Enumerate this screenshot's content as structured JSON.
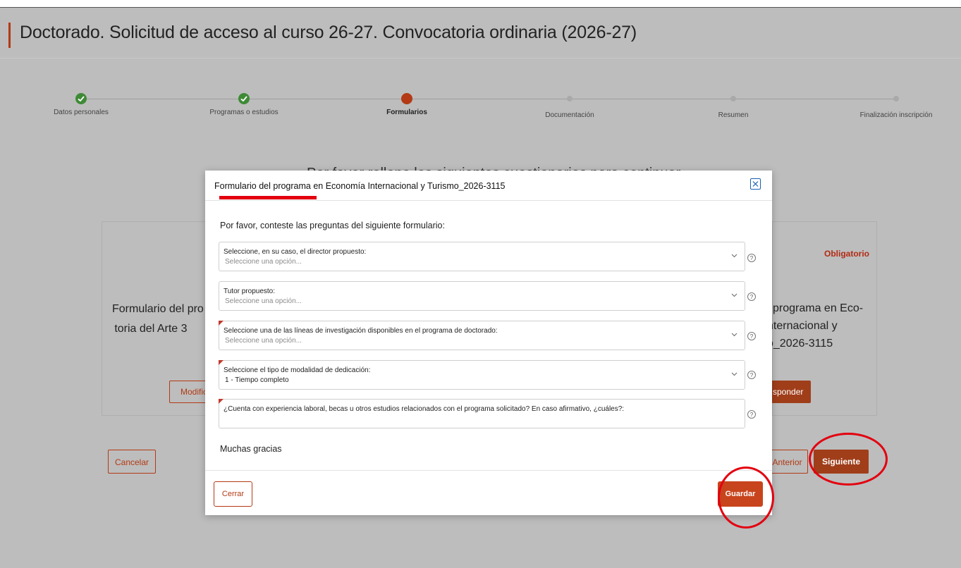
{
  "page": {
    "title": "Doctorado. Solicitud de acceso al curso 26-27. Convocatoria ordinaria (2026-27)",
    "background_heading": "Por favor rellene los siguientes cuestionarios para continuar"
  },
  "stepper": {
    "steps": [
      {
        "label": "Datos personales",
        "status": "done"
      },
      {
        "label": "Programas o estudios",
        "status": "done"
      },
      {
        "label": "Formularios",
        "status": "active"
      },
      {
        "label": "Documentación",
        "status": "pending"
      },
      {
        "label": "Resumen",
        "status": "pending"
      },
      {
        "label": "Finalización inscripción",
        "status": "pending"
      }
    ]
  },
  "background": {
    "left_card": {
      "line1": "Formulario del pro",
      "line2": "toria del Arte 3",
      "button": "Modific"
    },
    "right_card": {
      "badge": "Obligatorio",
      "line1": "l programa en Eco-",
      "line2": "nternacional y",
      "line3": "o_2026-3115",
      "button": "sponder"
    },
    "cancel_button": "Cancelar",
    "previous_button": "Anterior",
    "next_button": "Siguiente"
  },
  "modal": {
    "title": "Formulario del programa en Economía Internacional y Turismo_2026-3115",
    "intro": "Por favor, conteste las preguntas del siguiente formulario:",
    "fields": [
      {
        "label": "Seleccione, en su caso, el director propuesto:",
        "value": "Seleccione una opción...",
        "required": false
      },
      {
        "label": "Tutor propuesto:",
        "value": "Seleccione una opción...",
        "required": false
      },
      {
        "label": "Seleccione una de las líneas de investigación disponibles en el programa de doctorado:",
        "value": "Seleccione una opción...",
        "required": true
      },
      {
        "label": "Seleccione el tipo de modalidad de dedicación:",
        "value": "1 - Tiempo completo",
        "required": true
      },
      {
        "label": "¿Cuenta con experiencia laboral, becas u otros estudios relacionados con el programa solicitado? En caso afirmativo, ¿cuáles?:",
        "value": "",
        "required": true
      }
    ],
    "closing": "Muchas gracias",
    "close_button": "Cerrar",
    "save_button": "Guardar",
    "help_glyph": "?"
  },
  "colors": {
    "accent": "#b33a14",
    "done": "#3f8a37",
    "annotation": "#e3000f",
    "overlay_bg": "#bdbdbd"
  }
}
